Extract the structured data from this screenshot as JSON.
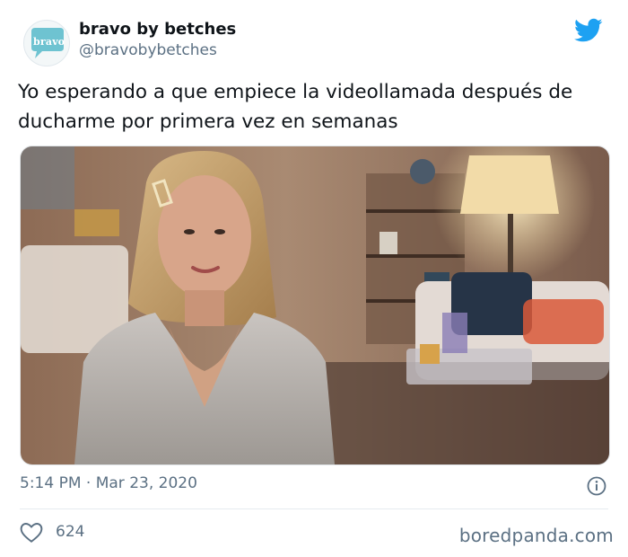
{
  "tweet": {
    "avatar_text": "bravo",
    "display_name": "bravo by betches",
    "handle": "@bravobybetches",
    "text_lines": [
      "Yo esperando a que empiece la videollamada después de",
      "ducharme por primera vez en semanas"
    ],
    "timestamp": "5:14 PM · Mar 23, 2020",
    "like_count": "624"
  },
  "media": {
    "description_icon": "photo"
  },
  "watermark": "boredpanda.com",
  "colors": {
    "twitter_blue": "#1da1f2",
    "secondary_text": "#5b7083",
    "avatar_bubble": "#6ec3d1"
  }
}
